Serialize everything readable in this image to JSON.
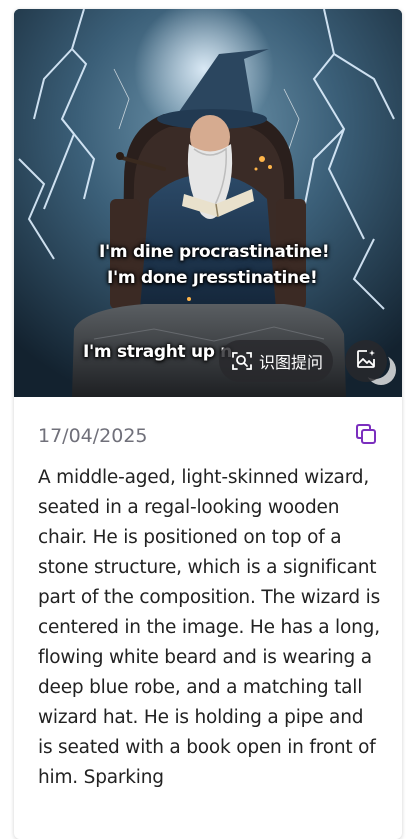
{
  "image_overlay": {
    "line1": "I'm dine procrastinatine!",
    "line2": "I'm done ȷresstinatine!",
    "line3": "I'm straght up n"
  },
  "actions": {
    "ocr_label": "识图提问",
    "ocr_icon": "scan-text-icon",
    "image_action_icon": "image-sparkle-icon",
    "copy_icon": "copy-icon"
  },
  "meta": {
    "date": "17/04/2025"
  },
  "description": "A middle-aged, light-skinned wizard, seated in a regal-looking wooden chair. He is positioned on top of a stone structure, which is a significant part of the composition. The wizard is centered in the image. He has a long, flowing white beard and is wearing a deep blue robe, and a matching tall wizard hat. He is holding a pipe and is seated with a book open in front of him. Sparking",
  "colors": {
    "accent": "#7b2fbe",
    "date_text": "#70707a",
    "body_text": "#222222"
  }
}
